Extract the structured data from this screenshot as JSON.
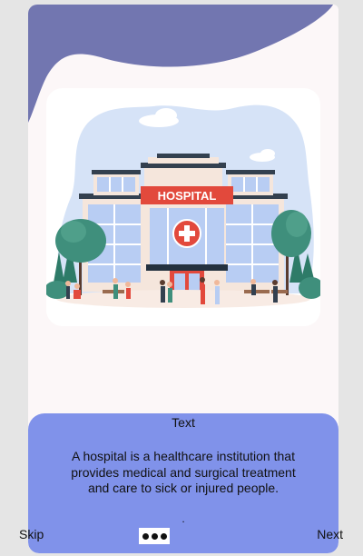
{
  "illustration": {
    "sign_text": "HOSPITAL",
    "colors": {
      "sky_blob": "#d6e3f7",
      "building": "#f5e6dc",
      "glass": "#b8cdf3",
      "sign": "#e2493c",
      "trees": "#3f8f7c"
    }
  },
  "panel": {
    "title": "Text",
    "body": "A hospital is a healthcare institution that provides medical and surgical treatment and care to sick or injured people.",
    "dot": "."
  },
  "nav": {
    "skip_label": "Skip",
    "next_label": "Next",
    "dots_icon": "more-dots-icon"
  },
  "colors": {
    "background": "#fcf7f8",
    "top_wave": "#7276b0",
    "panel": "#8092ea"
  }
}
